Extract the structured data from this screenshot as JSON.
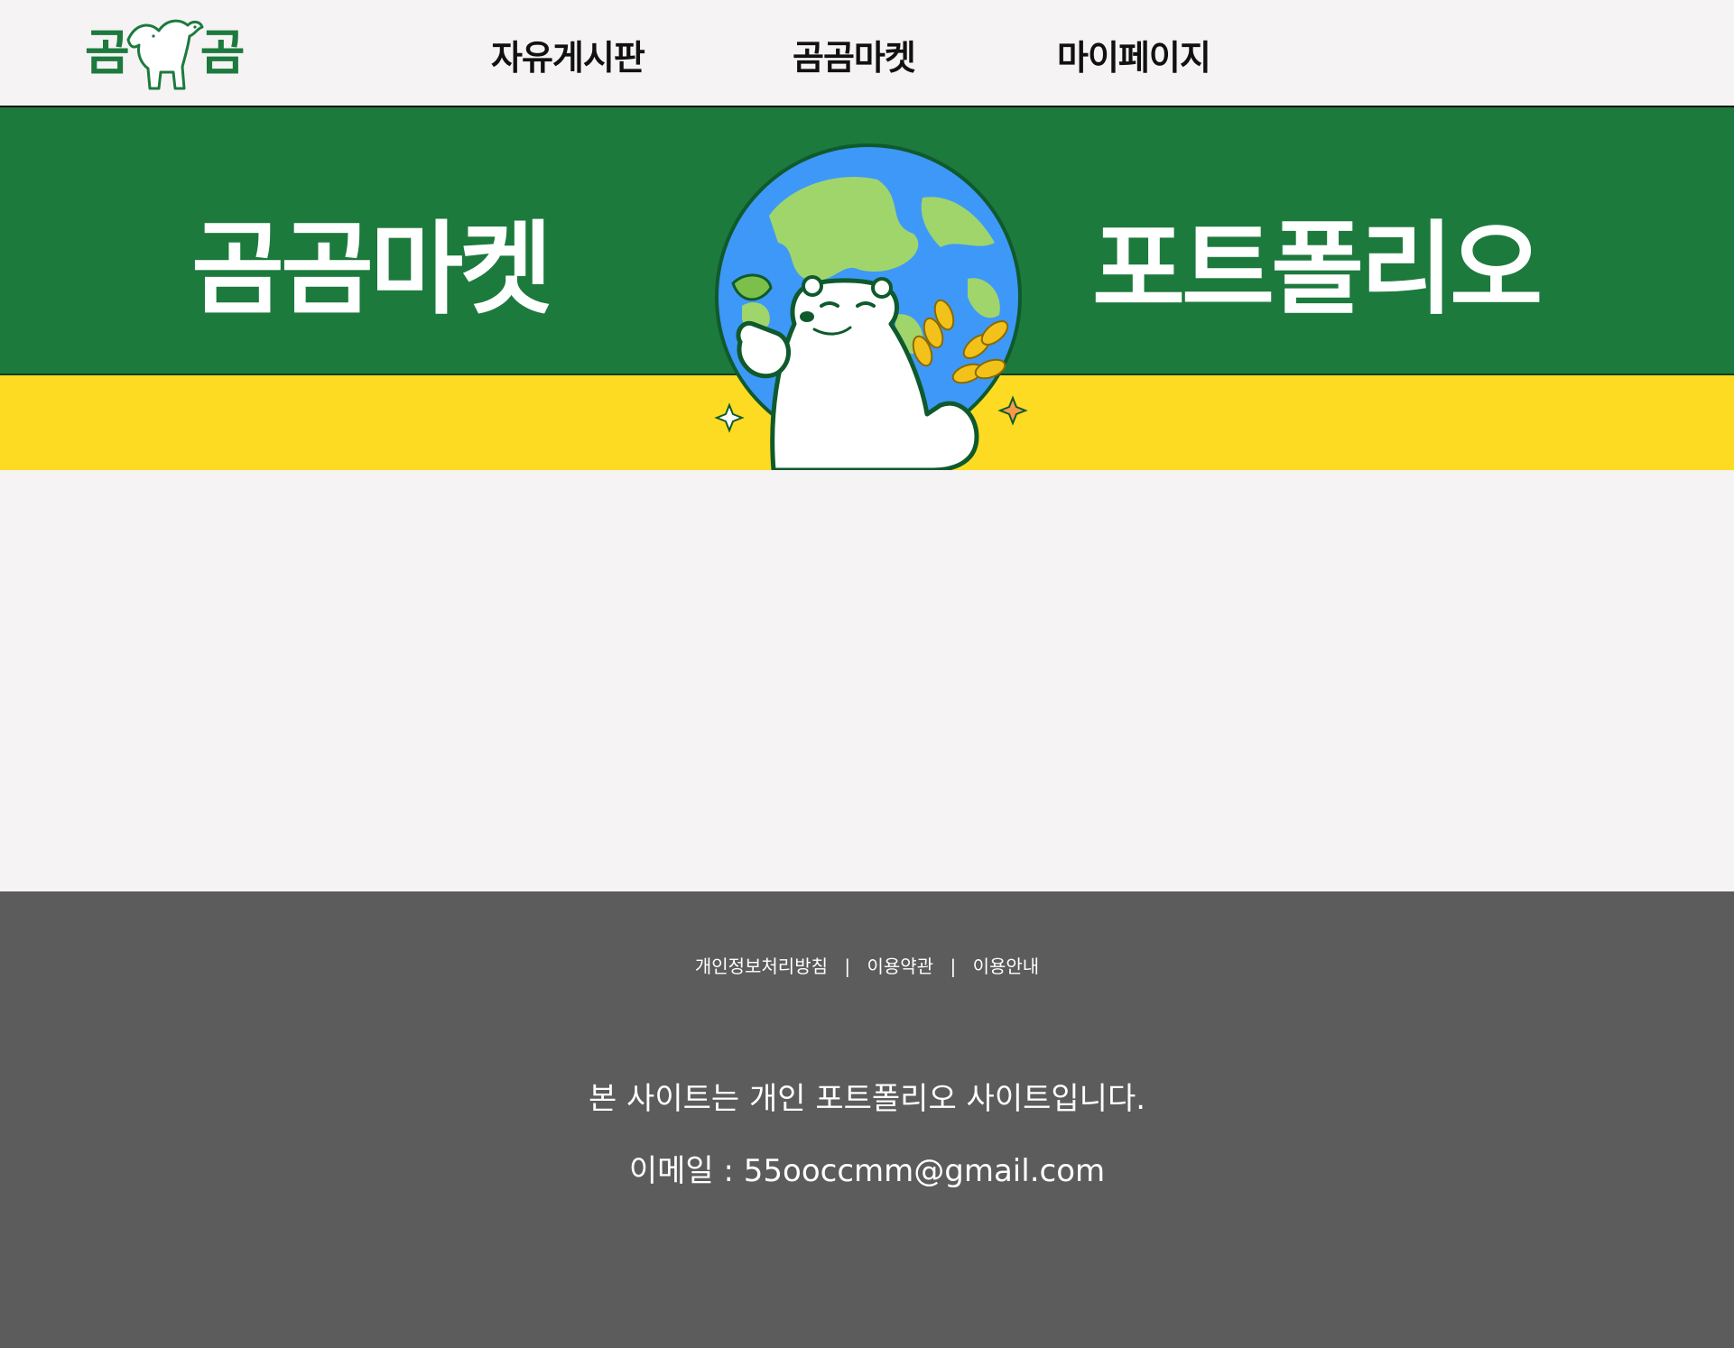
{
  "header": {
    "logo": {
      "left": "곰",
      "right": "곰"
    },
    "nav": [
      {
        "label": "자유게시판"
      },
      {
        "label": "곰곰마켓"
      },
      {
        "label": "마이페이지"
      }
    ]
  },
  "banner": {
    "title_left": "곰곰마켓",
    "title_right": "포트폴리오",
    "colors": {
      "green": "#1c7a3d",
      "yellow": "#fddb22",
      "ocean": "#3e98f7",
      "land": "#a0d56b"
    }
  },
  "footer": {
    "links": [
      {
        "label": "개인정보처리방침"
      },
      {
        "label": "이용약관"
      },
      {
        "label": "이용안내"
      }
    ],
    "separator": "|",
    "notice": "본 사이트는 개인 포트폴리오 사이트입니다.",
    "email": "이메일 : 55ooccmm@gmail.com"
  }
}
